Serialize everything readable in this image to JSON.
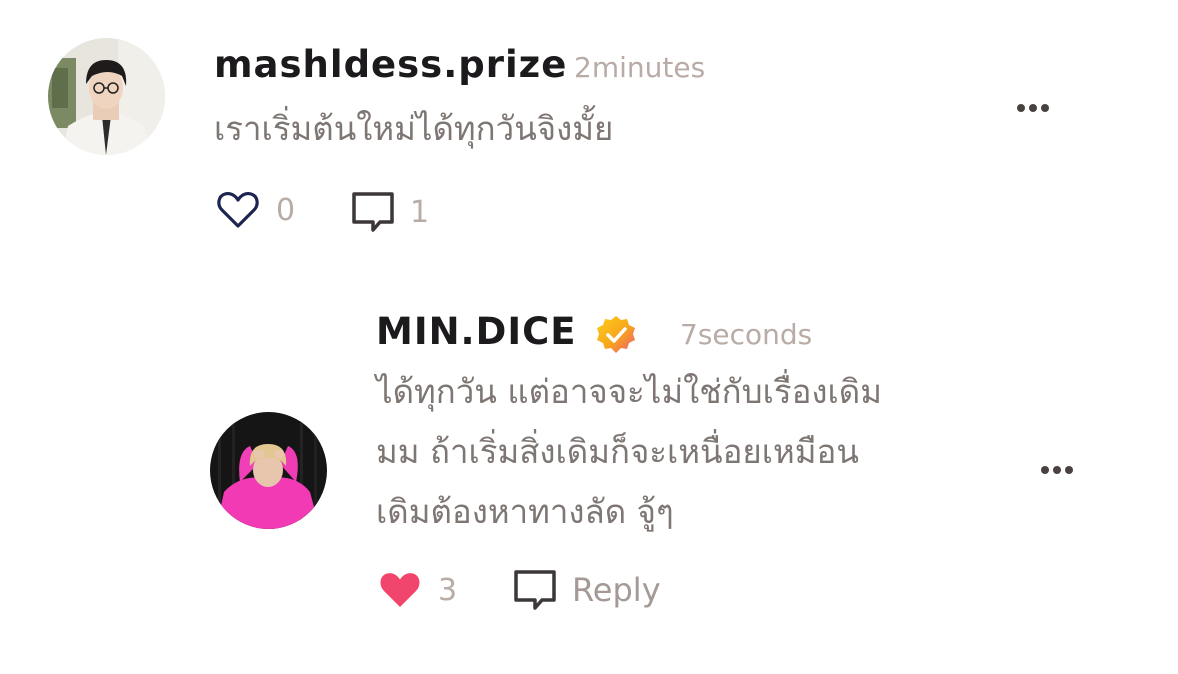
{
  "comments": [
    {
      "username": "mashldess.prize",
      "time": "2minutes",
      "text_lines": [
        "เราเริ่มต้นใหม่ได้ทุกวันจิงมั้ย"
      ],
      "likes": "0",
      "replies": "1",
      "liked": false
    }
  ],
  "reply": {
    "username": "MIN.DICE",
    "verified": true,
    "time": "7seconds",
    "text_lines": [
      "ได้ทุกวัน แต่อาจจะไม่ใช่กับเรื่องเดิม",
      "มม ถ้าเริ่มสิ่งเดิมก็จะเหนื่อยเหมือน",
      "เดิมต้องหาทางลัด จู้ๆ"
    ],
    "likes": "3",
    "reply_label": "Reply",
    "liked": true
  },
  "colors": {
    "username": "#1c1a1c",
    "meta": "#b9aba6",
    "body": "#7e7673",
    "heart_outline": "#1b2550",
    "heart_filled": "#f2456e",
    "verified_badge": "#f7a51b"
  },
  "icons": {
    "like": "heart-icon",
    "comment": "comment-bubble-icon",
    "more": "more-dots-icon",
    "verified": "verified-check-icon"
  }
}
